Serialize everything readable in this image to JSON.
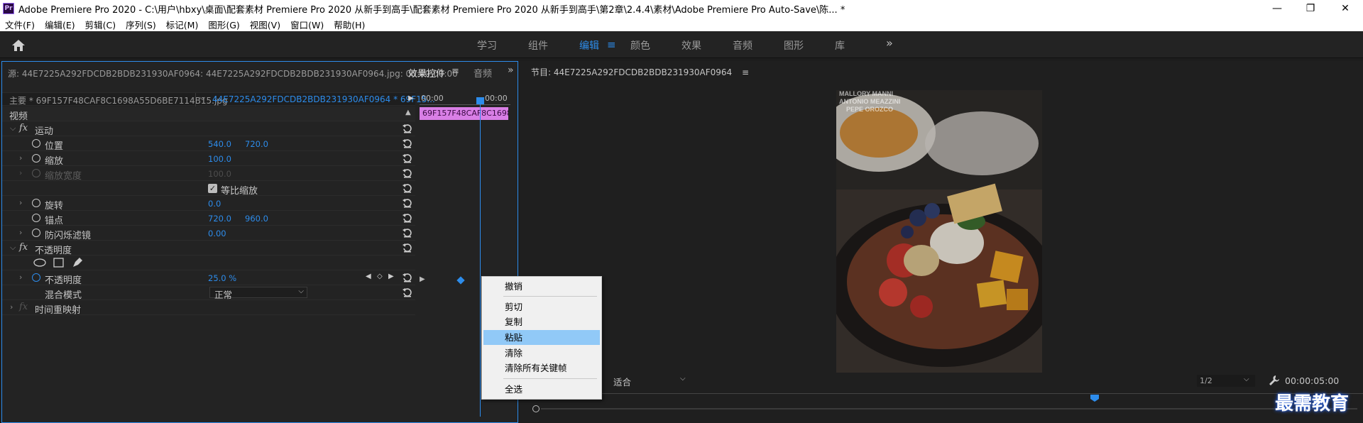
{
  "window": {
    "title": "Adobe Premiere Pro 2020 - C:\\用户\\hbxy\\桌面\\配套素材 Premiere Pro 2020 从新手到高手\\配套素材 Premiere Pro 2020 从新手到高手\\第2章\\2.4.4\\素材\\Adobe Premiere Pro Auto-Save\\陈...  *",
    "app_icon": "Pr",
    "minimize": "—",
    "maximize": "❐",
    "close": "✕"
  },
  "menubar": [
    "文件(F)",
    "编辑(E)",
    "剪辑(C)",
    "序列(S)",
    "标记(M)",
    "图形(G)",
    "视图(V)",
    "窗口(W)",
    "帮助(H)"
  ],
  "workspaces": {
    "tabs": [
      "学习",
      "组件",
      "编辑",
      "颜色",
      "效果",
      "音频",
      "图形",
      "库"
    ],
    "active": "编辑",
    "more": "»"
  },
  "effect_controls": {
    "source_title": "源: 44E7225A292FDCDB2BDB231930AF0964: 44E7225A292FDCDB2BDB231930AF0964.jpg: 00:00:00:00",
    "tab_effects": "效果控件",
    "tab_effects_menu": "≡",
    "tab_audio": "音频",
    "tab_more": "»",
    "master_clip": "主要 * 69F157F48CAF8C1698A55D6BE7114B15.jpg",
    "sequence_clip": "44E7225A292FDCDB2BDB231930AF0964 * 69F15...",
    "section_video": "视频",
    "fx_glyph": "fx",
    "motion": "运动",
    "position": {
      "label": "位置",
      "x": "540.0",
      "y": "720.0"
    },
    "scale": {
      "label": "缩放",
      "value": "100.0"
    },
    "scale_width": {
      "label": "缩放宽度",
      "value": "100.0"
    },
    "uniform_scale": {
      "label": "等比缩放",
      "checked": true
    },
    "rotation": {
      "label": "旋转",
      "value": "0.0"
    },
    "anchor": {
      "label": "锚点",
      "x": "720.0",
      "y": "960.0"
    },
    "anti_flicker": {
      "label": "防闪烁滤镜",
      "value": "0.00"
    },
    "opacity_section": "不透明度",
    "opacity": {
      "label": "不透明度",
      "value": "25.0 %"
    },
    "blend_mode": {
      "label": "混合模式",
      "value": "正常"
    },
    "time_remap": "时间重映射",
    "timeline": {
      "t0": "00:00",
      "t1": "00:00",
      "clip": "69F157F48CAF8C1698A"
    }
  },
  "context_menu": {
    "items": [
      "撤销",
      "剪切",
      "复制",
      "粘贴",
      "清除",
      "清除所有关键帧",
      "全选"
    ],
    "highlighted": "粘贴"
  },
  "program_monitor": {
    "title": "节目: 44E7225A292FDCDB2BDB231930AF0964",
    "title_menu": "≡",
    "fit": "适合",
    "resolution": "1/2",
    "duration": "00:00:05:00",
    "overlay_text": [
      "MALLORY MANNI",
      "ANTONIO MEAZZINI",
      "PEPE OROZCO"
    ]
  },
  "watermark": "最需教育",
  "colors": {
    "accent": "#2d8ceb",
    "clip": "#d97fe6",
    "highlight": "#91c9f7"
  }
}
